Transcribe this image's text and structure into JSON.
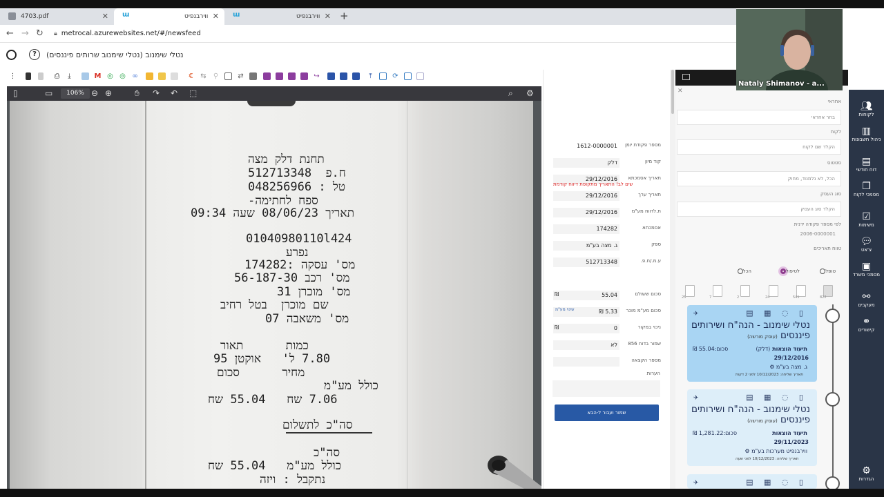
{
  "browser": {
    "tabs": [
      {
        "label": "4703.pdf",
        "type": "pdf"
      },
      {
        "label": "ווירבנפיט",
        "type": "w"
      },
      {
        "label": "ווירבנפיט",
        "type": "w"
      }
    ],
    "url": "metrocal.azurewebsites.net/#/newsfeed"
  },
  "app": {
    "header_title": "נטלי שימנוב (נטלי שימנוב שרותים פיננסים)"
  },
  "pdf": {
    "zoom": "106%",
    "receipt_lines": [
      "תחנת דלק מצה",
      "ח.פ  512713348",
      "טל : 048256966",
      "ספח לחתימה-",
      "תאריך 08/06/23 שעה 09:34",
      "01040980110l424",
      "נפרע",
      "מס' עסקה :174282",
      "מס' רכב 56-187-30",
      "מס' מוכרן 31",
      "שם מוכרן  בטל רחיב",
      "מס' משאבה 07",
      "כמות      תאור",
      "7.80 ל'   אוקטן 95",
      "מחיר      סכום",
      "כולל מע\"מ",
      "7.06 שח   55.04 שח",
      "סה\"כ לתשלום",
      "סה\"כ",
      "כולל מע\"מ   55.04 שח",
      "נתקבל : ויזה"
    ]
  },
  "form": {
    "fields": [
      {
        "label": "מספר פקודת יומן",
        "value": "1612-0000001"
      },
      {
        "label": "קוד מיון",
        "value": "דלק"
      },
      {
        "label": "תאריך אסמכתא",
        "value": "29/12/2016"
      },
      {
        "label": "תאריך ערך",
        "value": "29/12/2016"
      },
      {
        "label": "ת.לדווח מע\"מ",
        "value": "29/12/2016"
      },
      {
        "label": "אסמכתא",
        "value": "174282"
      },
      {
        "label": "ספק",
        "value": "ג. מצה בע\"מ"
      },
      {
        "label": "ע.מ./ח.פ.",
        "value": "512713348"
      },
      {
        "label": "סכום ששולם",
        "value": "55.04"
      },
      {
        "label": "סכום מע\"מ מוכר",
        "value": "5.33 ₪"
      },
      {
        "label": "ניכוי במקור",
        "value": "0"
      },
      {
        "label": "שמור בדוח 856",
        "value": "לא"
      },
      {
        "label": "מספר הקצאה",
        "value": ""
      }
    ],
    "currency": "₪",
    "warning": "שים לב! התאריך מתקופת דיווח קודמת",
    "vat_link": "שינוי מע\"מ",
    "notes_label": "הערות",
    "save_label": "שמור ועבור ל-הבא"
  },
  "list": {
    "filters": [
      {
        "label": "אחראי",
        "placeholder": "בחר אחראי"
      },
      {
        "label": "לקוח",
        "placeholder": "הקלד שם לקוח"
      },
      {
        "label": "סטטוס",
        "placeholder": "הכל, לא נלמנוד, מחוק"
      },
      {
        "label": "סוג העסק",
        "placeholder": "הקלד סוג העסק"
      },
      {
        "label": "לפי מספר פקודה ידנית",
        "placeholder": "2006-0000001"
      },
      {
        "label": "טווח תאריכים",
        "placeholder": ""
      }
    ],
    "radios": [
      "טופל",
      "לטיפול",
      "הכל"
    ],
    "doc_counts": [
      "822",
      "541",
      "24",
      "2",
      "7",
      "25"
    ],
    "cards": [
      {
        "name": "נטלי שימנוב - הנה\"ח ושירותים פיננסים",
        "sub": "(עוסק מורשה)",
        "type": "תיעוד הוצאות",
        "category": "(דלק)",
        "sum": "סכום:55.04 ₪",
        "date": "29/12/2016",
        "vendor": "ג. מצה בע\"מ",
        "sent": "תאריך שליחה: 10/12/2023 לפני 2 דקות"
      },
      {
        "name": "נטלי שימנוב - הנה\"ח ושירותים פיננסים",
        "sub": "(עוסק מורשה)",
        "type": "תיעוד הוצאות",
        "category": "",
        "sum": "סכום:1,281.22 ₪",
        "date": "29/11/2023",
        "vendor": "ווירבנפיט מערכות בע\"מ",
        "sent": "תאריך שליחה: 10/12/2023 לפני שעה"
      }
    ]
  },
  "sidebar": {
    "items": [
      {
        "label": "לקוחות",
        "icon": "users-icon"
      },
      {
        "label": "ניהול חשבונות",
        "icon": "chart-icon"
      },
      {
        "label": "דוח חודשי",
        "icon": "document-icon"
      },
      {
        "label": "מסמכי לקוח",
        "icon": "documents-icon"
      },
      {
        "label": "משימות",
        "icon": "checkbox-icon"
      },
      {
        "label": "צ'אט",
        "icon": "chat-icon"
      },
      {
        "label": "מסמכי משרד",
        "icon": "archive-icon"
      },
      {
        "label": "מעקבים",
        "icon": "binoculars-icon"
      },
      {
        "label": "קישורים",
        "icon": "link-icon"
      },
      {
        "label": "הגדרות",
        "icon": "gears-icon"
      }
    ]
  },
  "webcam": {
    "name": "Nataly Shimanov - a..."
  }
}
